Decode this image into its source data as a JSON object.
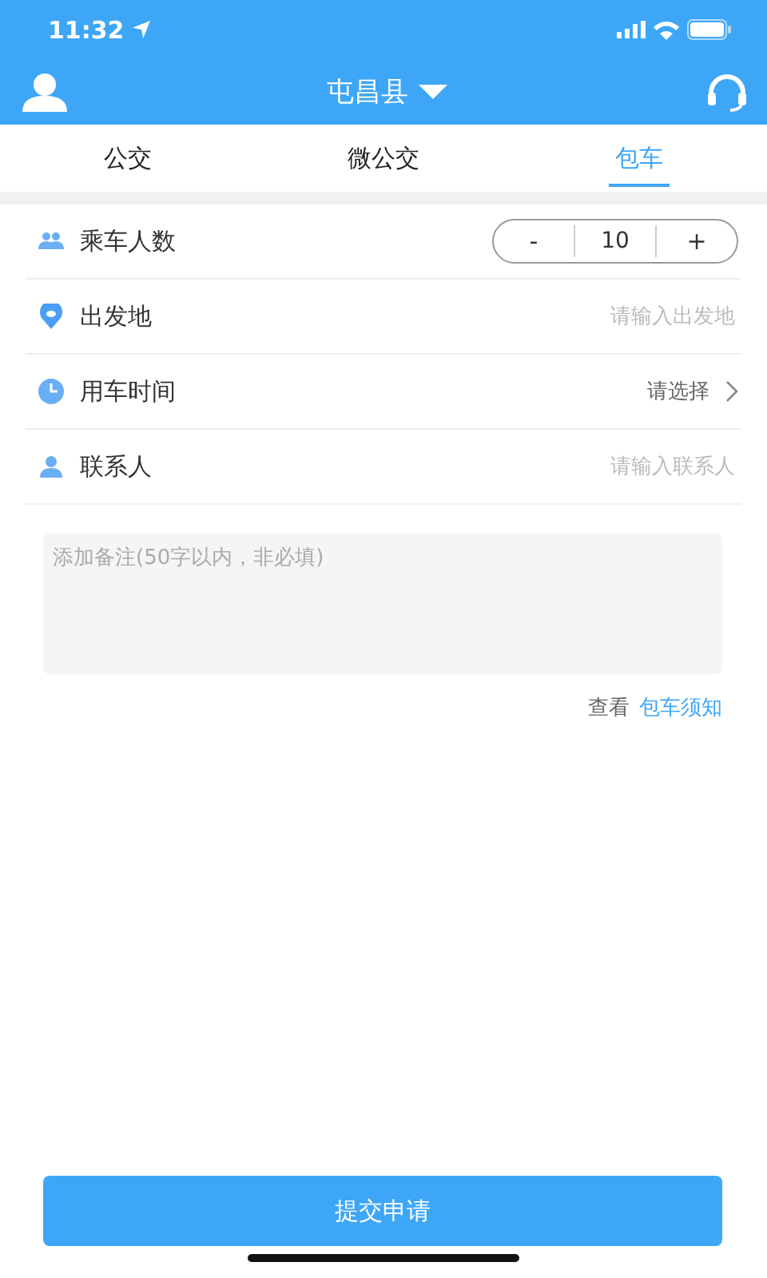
{
  "status_bar": {
    "time": "11:32"
  },
  "header": {
    "title": "屯昌县"
  },
  "tabs": [
    {
      "label": "公交",
      "selected": false
    },
    {
      "label": "微公交",
      "selected": false
    },
    {
      "label": "包车",
      "selected": true
    }
  ],
  "form": [
    {
      "kind": "stepper",
      "label": "乘车人数",
      "minus": "-",
      "value": "10",
      "plus": "+"
    },
    {
      "kind": "input",
      "label": "出发地",
      "placeholder": "请输入出发地"
    },
    {
      "kind": "select",
      "label": "用车时间",
      "value": "请选择"
    },
    {
      "kind": "input",
      "label": "联系人",
      "placeholder": "请输入联系人"
    }
  ],
  "note": {
    "placeholder": "添加备注(50字以内，非必填)"
  },
  "notice": {
    "prefix": "查看",
    "link": "包车须知"
  },
  "submit": {
    "label": "提交申请"
  }
}
